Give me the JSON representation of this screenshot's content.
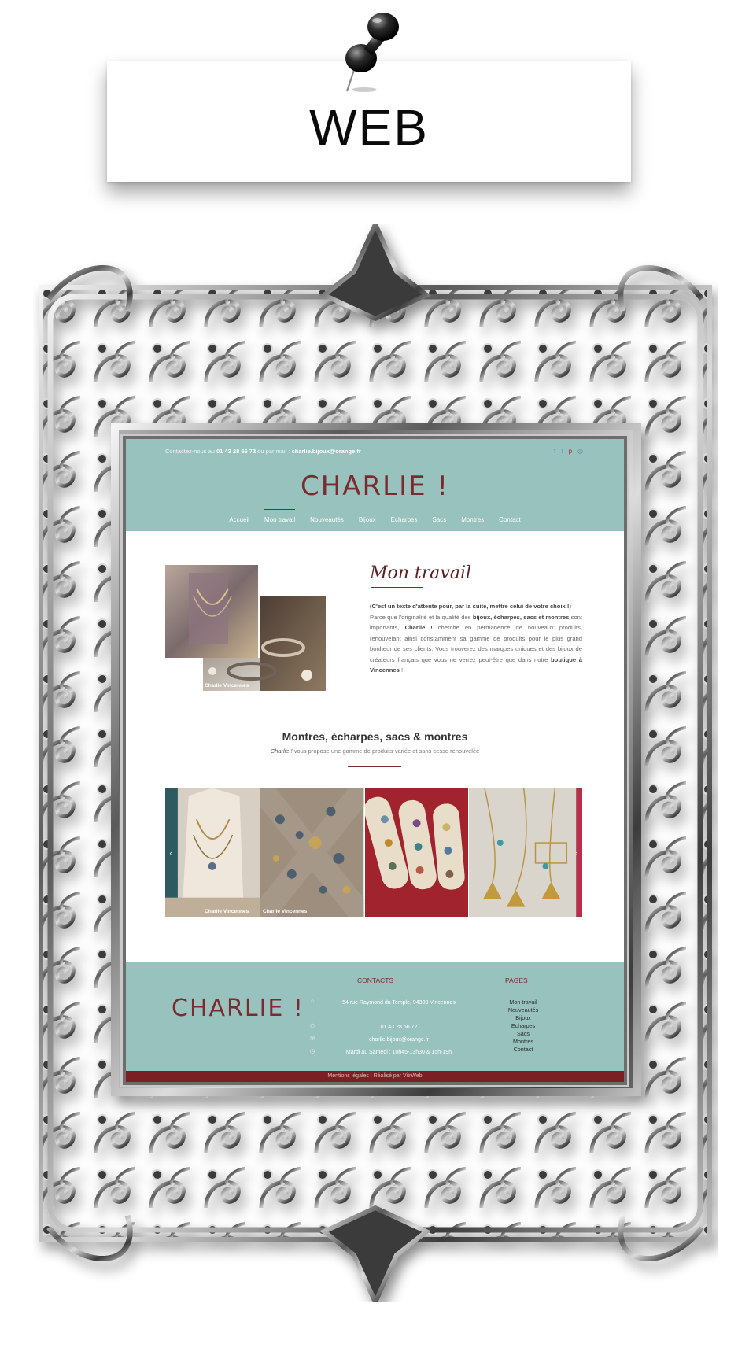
{
  "banner": {
    "title": "WEB"
  },
  "site": {
    "header": {
      "contact_prefix": "Contactez-nous au",
      "phone": "01 43 28 56 72",
      "contact_mid": "ou par mail :",
      "email": "charlie.bijoux@orange.fr",
      "logo": "CHARLIE !",
      "socials": [
        "f",
        "t",
        "p",
        "◎"
      ],
      "nav": [
        "Accueil",
        "Mon travail",
        "Nouveautés",
        "Bijoux",
        "Echarpes",
        "Sacs",
        "Montres",
        "Contact"
      ],
      "active_nav": "Mon travail"
    },
    "mon_travail": {
      "title": "Mon travail",
      "p1_bold": "(C'est un texte d'attente pour, par la suite, mettre celui de votre choix !)",
      "p2_a": "Parce que l'originalité et la qualité des",
      "p2_bold1": "bijoux, écharpes, sacs et montres",
      "p2_b": "sont importants,",
      "p2_bold2": "Charlie !",
      "p2_c": "cherche en permanence de nouveaux produits, renouvelant ainsi constamment sa gamme de produits pour le plus grand bonheur de ses clients. Vous trouverez des marques uniques et des bijoux de créateurs français que vous ne verrez peut-être que dans notre",
      "p2_bold3": "boutique à Vincennes",
      "p2_d": "!",
      "photo_caption": "Charlie Vincennes"
    },
    "section": {
      "title": "Montres, écharpes, sacs & montres",
      "subtitle_italic": "Charlie !",
      "subtitle_rest": "vous propose une gamme de produits variée et sans cesse renouvelée",
      "captions": [
        "Charlie Vincennes",
        "Charlie Vincennes"
      ],
      "arrow_left": "‹",
      "arrow_right": "›"
    },
    "footer": {
      "logo": "CHARLIE !",
      "contacts_heading": "CONTACTS",
      "pages_heading": "PAGES",
      "address": "54 rue Raymond du Temple, 94300 Vincennes",
      "phone": "01 43 28 56 72",
      "email": "charlie.bijoux@orange.fr",
      "hours": "Mardi au Samedi : 10h45-13h30 & 15h-19h",
      "pages": [
        "Mon travail",
        "Nouveautés",
        "Bijoux",
        "Echarpes",
        "Sacs",
        "Montres",
        "Contact"
      ],
      "bottom_text": "Mentions légales | Réalisé par VitrWeb"
    }
  }
}
